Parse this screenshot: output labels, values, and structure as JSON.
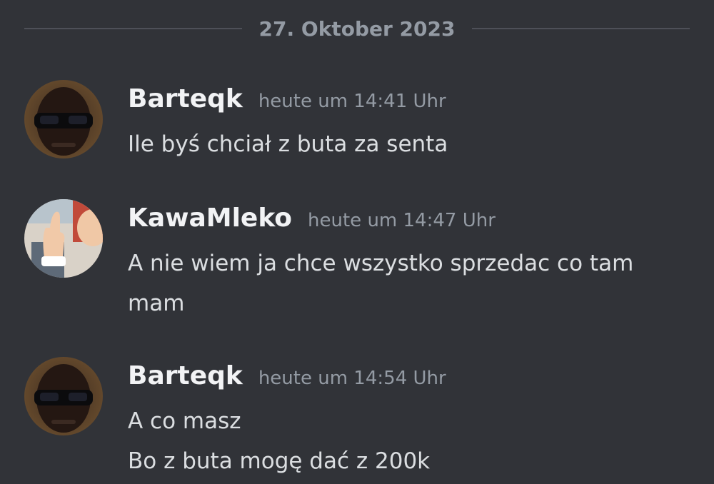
{
  "date_divider": "27. Oktober 2023",
  "messages": [
    {
      "username": "Barteqk",
      "timestamp": "heute um 14:41 Uhr",
      "lines": [
        "Ile byś chciał z buta za senta"
      ],
      "avatar_icon": "person-sunglasses-avatar"
    },
    {
      "username": "KawaMleko",
      "timestamp": "heute um 14:47 Uhr",
      "lines": [
        "A nie wiem ja chce wszystko sprzedac co tam mam"
      ],
      "avatar_icon": "hand-gesture-avatar"
    },
    {
      "username": "Barteqk",
      "timestamp": "heute um 14:54 Uhr",
      "lines": [
        "A co masz",
        "Bo z buta mogę dać z 200k"
      ],
      "avatar_icon": "person-sunglasses-avatar"
    }
  ],
  "colors": {
    "background": "#313338",
    "username": "#f2f3f5",
    "timestamp": "#949ba4",
    "message_text": "#dbdee1",
    "divider": "#4e5058"
  }
}
